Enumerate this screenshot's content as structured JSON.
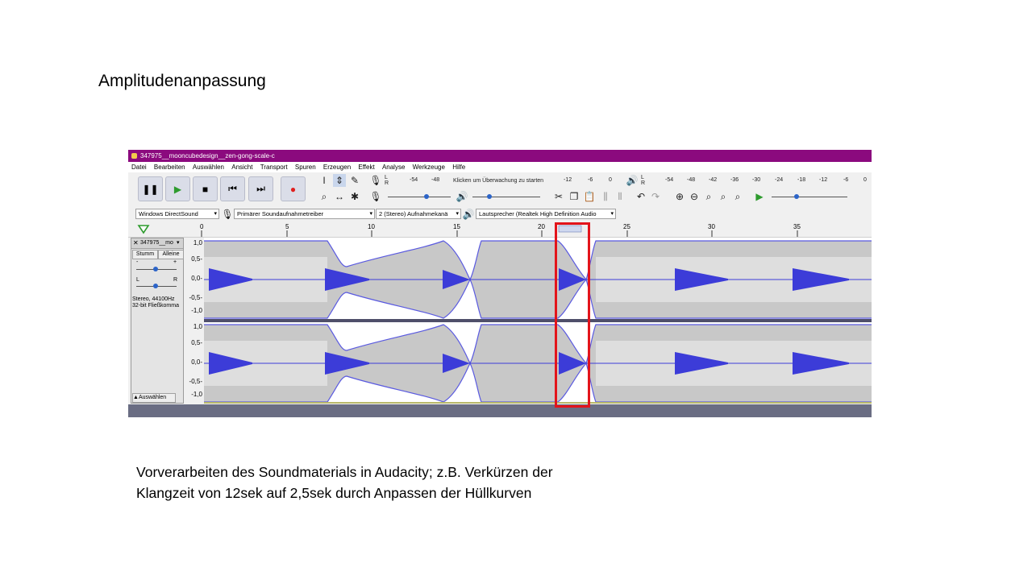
{
  "slide": {
    "title": "Amplitudenanpassung",
    "caption_line1": "Vorverarbeiten des Soundmaterials  in Audacity; z.B. Verkürzen  der",
    "caption_line2": "Klangzeit  von 12sek auf 2,5sek durch Anpassen der Hüllkurven"
  },
  "window": {
    "title": "347975__mooncubedesign__zen-gong-scale-c"
  },
  "menu": [
    "Datei",
    "Bearbeiten",
    "Auswählen",
    "Ansicht",
    "Transport",
    "Spuren",
    "Erzeugen",
    "Effekt",
    "Analyse",
    "Werkzeuge",
    "Hilfe"
  ],
  "meters": {
    "record_scale": [
      "-54",
      "-48",
      "-12",
      "-6",
      "0"
    ],
    "record_hint": "Klicken um Überwachung zu starten",
    "play_scale": [
      "-54",
      "-48",
      "-42",
      "-36",
      "-30",
      "-24",
      "-18",
      "-12",
      "-6",
      "0"
    ]
  },
  "devices": {
    "host": "Windows DirectSound",
    "input": "Primärer Soundaufnahmetreiber",
    "channels": "2 (Stereo) Aufnahmekanä",
    "output": "Lautsprecher (Realtek High Definition Audio"
  },
  "timeline": {
    "ticks": [
      "0",
      "5",
      "10",
      "15",
      "20",
      "25",
      "30",
      "35"
    ]
  },
  "track": {
    "name": "347975__mo",
    "mute_label": "Stumm",
    "solo_label": "Alleine",
    "gain_minus": "-",
    "gain_plus": "+",
    "pan_left": "L",
    "pan_right": "R",
    "info_line1": "Stereo, 44100Hz",
    "info_line2": "32-bit Fließkomma",
    "select_label": "Auswählen",
    "ruler": [
      "1,0",
      "0,5-",
      "0,0-",
      "-0,5-",
      "-1,0"
    ]
  },
  "colors": {
    "titlebar": "#8b0a7e",
    "waveform": "#3c3cd8",
    "envelope_fill": "#c8c8c8",
    "highlight": "#e3141b"
  }
}
